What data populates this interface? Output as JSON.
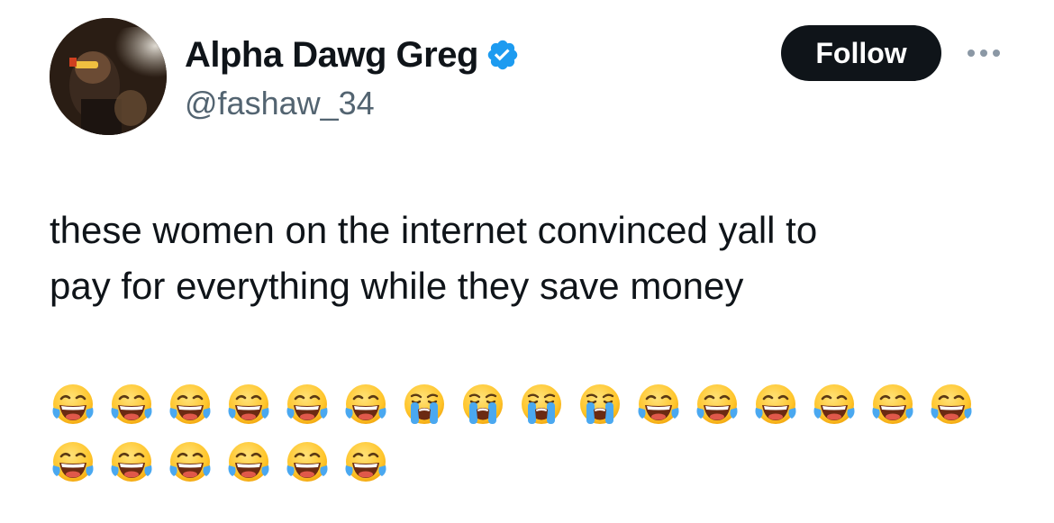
{
  "author": {
    "display_name": "Alpha Dawg Greg",
    "handle": "@fashaw_34",
    "verified": true
  },
  "actions": {
    "follow_label": "Follow"
  },
  "colors": {
    "text_primary": "#0f1419",
    "text_secondary": "#536471",
    "verified_blue": "#1d9bf0",
    "follow_bg": "#0f1419"
  },
  "tweet": {
    "text_lines": [
      "these women on the internet convinced yall to",
      "pay for everything while they save money"
    ],
    "emoji_rows": [
      [
        "joy",
        "joy",
        "joy",
        "joy",
        "joy",
        "joy",
        "sob",
        "sob",
        "sob",
        "sob",
        "joy",
        "joy",
        "joy",
        "joy",
        "joy",
        "joy"
      ],
      [
        "joy",
        "joy",
        "joy",
        "joy",
        "joy",
        "joy"
      ]
    ]
  }
}
